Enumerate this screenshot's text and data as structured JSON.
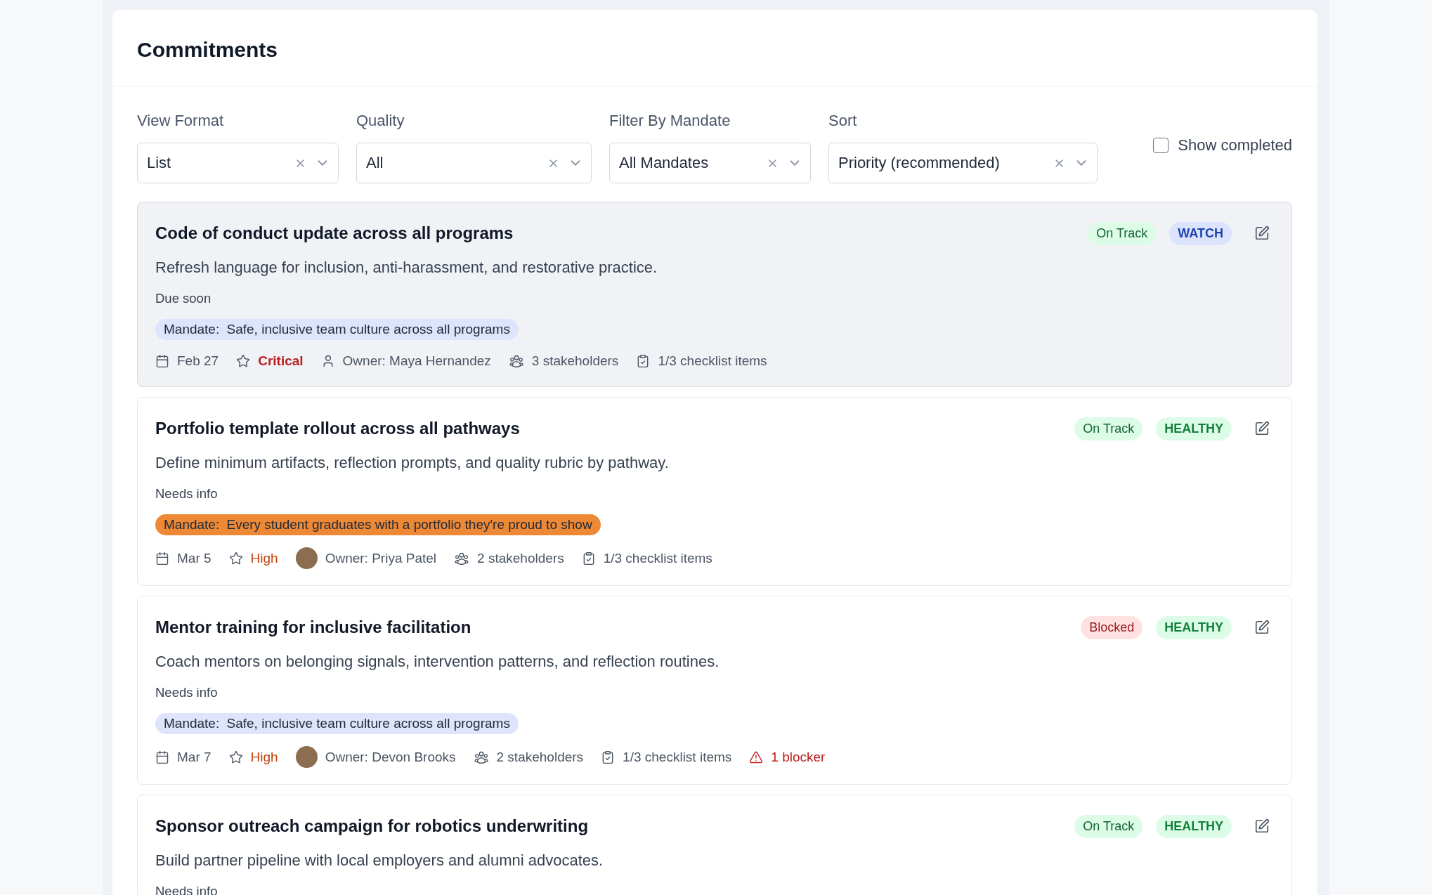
{
  "panel": {
    "title": "Commitments"
  },
  "filters": [
    {
      "label": "View Format",
      "value": "List"
    },
    {
      "label": "Quality",
      "value": "All"
    },
    {
      "label": "Filter By Mandate",
      "value": "All Mandates"
    },
    {
      "label": "Sort",
      "value": "Priority (recommended)"
    }
  ],
  "show_completed": {
    "label": "Show completed",
    "checked": false
  },
  "commitments": [
    {
      "selected": true,
      "title": "Code of conduct update across all programs",
      "status": {
        "text": "On Track",
        "kind": "on_track"
      },
      "health": {
        "text": "WATCH",
        "kind": "watch"
      },
      "description": "Refresh language for inclusion, anti-harassment, and restorative practice.",
      "note": "Due soon",
      "mandate": {
        "label": "Mandate:",
        "name": "Safe, inclusive team culture across all programs",
        "color": "#dde4fb"
      },
      "meta": [
        {
          "kind": "date",
          "text": "Feb 27"
        },
        {
          "kind": "priority",
          "critical": true,
          "text": "Critical"
        },
        {
          "kind": "owner",
          "photo": false,
          "text": "Owner: Maya Hernandez"
        },
        {
          "kind": "stakeholders",
          "text": "3 stakeholders"
        },
        {
          "kind": "checklist",
          "text": "1/3 checklist items"
        }
      ]
    },
    {
      "selected": false,
      "title": "Portfolio template rollout across all pathways",
      "status": {
        "text": "On Track",
        "kind": "on_track"
      },
      "health": {
        "text": "HEALTHY",
        "kind": "healthy"
      },
      "description": "Define minimum artifacts, reflection prompts, and quality rubric by pathway.",
      "note": "Needs info",
      "mandate": {
        "label": "Mandate:",
        "name": "Every student graduates with a portfolio they're proud to show",
        "color": "#ed8936"
      },
      "meta": [
        {
          "kind": "date",
          "text": "Mar 5"
        },
        {
          "kind": "priority",
          "critical": false,
          "text": "High"
        },
        {
          "kind": "owner",
          "photo": true,
          "text": "Owner: Priya Patel"
        },
        {
          "kind": "stakeholders",
          "text": "2 stakeholders"
        },
        {
          "kind": "checklist",
          "text": "1/3 checklist items"
        }
      ]
    },
    {
      "selected": false,
      "title": "Mentor training for inclusive facilitation",
      "status": {
        "text": "Blocked",
        "kind": "blocked"
      },
      "health": {
        "text": "HEALTHY",
        "kind": "healthy"
      },
      "description": "Coach mentors on belonging signals, intervention patterns, and reflection routines.",
      "note": "Needs info",
      "mandate": {
        "label": "Mandate:",
        "name": "Safe, inclusive team culture across all programs",
        "color": "#dde4fb"
      },
      "meta": [
        {
          "kind": "date",
          "text": "Mar 7"
        },
        {
          "kind": "priority",
          "critical": false,
          "text": "High"
        },
        {
          "kind": "owner",
          "photo": true,
          "text": "Owner: Devon Brooks"
        },
        {
          "kind": "stakeholders",
          "text": "2 stakeholders"
        },
        {
          "kind": "checklist",
          "text": "1/3 checklist items"
        },
        {
          "kind": "blocker",
          "text": "1 blocker"
        }
      ]
    },
    {
      "selected": false,
      "title": "Sponsor outreach campaign for robotics underwriting",
      "status": {
        "text": "On Track",
        "kind": "on_track"
      },
      "health": {
        "text": "HEALTHY",
        "kind": "healthy"
      },
      "description": "Build partner pipeline with local employers and alumni advocates.",
      "note": "Needs info"
    }
  ]
}
